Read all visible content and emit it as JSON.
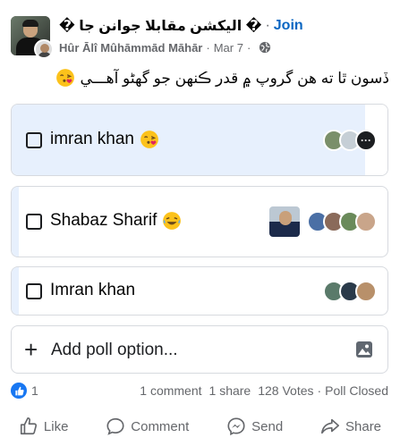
{
  "post": {
    "group_name": "� الیکشن مقابلا جوانن جا �",
    "join_label": "Join",
    "author": "Hûr Ālî Mûhāmmād Māhār",
    "date": "Mar 7",
    "text": "ڏسون ٿا ته هن گروپ ۾ قدر ڪنهن جو گهڻو آهـــي"
  },
  "poll": {
    "options": [
      {
        "label": "imran khan",
        "emoji": "kissing-heart-emoji",
        "fill_fraction": 0.95,
        "selected": false
      },
      {
        "label": "Shabaz Sharif",
        "emoji": "laughing-tears-emoji",
        "fill_fraction": 0.0,
        "selected": false
      },
      {
        "label": "Imran khan",
        "emoji": "",
        "fill_fraction": 0.0,
        "selected": false
      }
    ],
    "add_option_placeholder": "Add poll option..."
  },
  "stats": {
    "reactions_count": "1",
    "comments": "1 comment",
    "shares": "1 share",
    "votes": "128 Votes",
    "status": "Poll Closed"
  },
  "actions": {
    "like": "Like",
    "comment": "Comment",
    "send": "Send",
    "share": "Share"
  },
  "colors": {
    "accent": "#0a66c2",
    "poll_fill": "#e7f0fd",
    "like_blue": "#1877f2"
  }
}
